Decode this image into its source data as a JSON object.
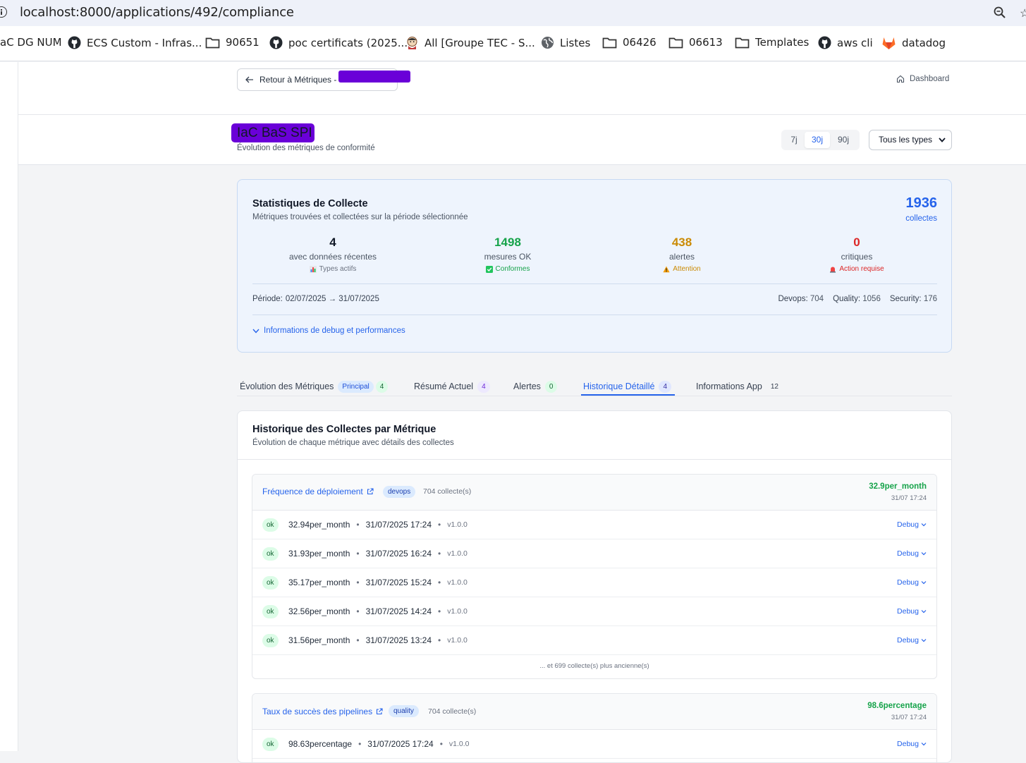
{
  "browser": {
    "url": "localhost:8000/applications/492/compliance",
    "bookmarks": [
      {
        "label": "aC DG NUM"
      },
      {
        "label": "ECS Custom - Infras..."
      },
      {
        "label": "90651"
      },
      {
        "label": "poc certificats (2025..."
      },
      {
        "label": "All [Groupe TEC - S..."
      },
      {
        "label": "Listes"
      },
      {
        "label": "06426"
      },
      {
        "label": "06613"
      },
      {
        "label": "Templates"
      },
      {
        "label": "aws cli"
      },
      {
        "label": "datadog"
      }
    ]
  },
  "nav": {
    "back_label": "Retour à Métriques -",
    "dashboard_label": "Dashboard"
  },
  "header": {
    "app_name": "IaC BaS SPI",
    "subtitle": "Évolution des métriques de conformité",
    "periods": [
      "7j",
      "30j",
      "90j"
    ],
    "active_period": "30j",
    "type_filter": "Tous les types"
  },
  "stats": {
    "title": "Statistiques de Collecte",
    "subtitle": "Métriques trouvées et collectées sur la période sélectionnée",
    "total": "1936",
    "total_label": "collectes",
    "items": [
      {
        "value": "4",
        "label": "avec données récentes",
        "sub": "Types actifs",
        "color": "#111827",
        "sub_color": "#6b7280"
      },
      {
        "value": "1498",
        "label": "mesures OK",
        "sub": "Conformes",
        "color": "#16a34a",
        "sub_color": "#16a34a"
      },
      {
        "value": "438",
        "label": "alertes",
        "sub": "Attention",
        "color": "#ca8a04",
        "sub_color": "#ca8a04"
      },
      {
        "value": "0",
        "label": "critiques",
        "sub": "Action requise",
        "color": "#dc2626",
        "sub_color": "#dc2626"
      }
    ],
    "period_label": "Période:",
    "period_value": "02/07/2025 → 31/07/2025",
    "breakdown": [
      {
        "label": "Devops:",
        "value": "704"
      },
      {
        "label": "Quality:",
        "value": "1056"
      },
      {
        "label": "Security:",
        "value": "176"
      }
    ],
    "debug_toggle": "Informations de debug et performances"
  },
  "tabs": [
    {
      "label": "Évolution des Métriques",
      "tag": "Principal",
      "count": "4"
    },
    {
      "label": "Résumé Actuel",
      "count": "4"
    },
    {
      "label": "Alertes",
      "count": "0"
    },
    {
      "label": "Historique Détaillé",
      "count": "4"
    },
    {
      "label": "Informations App",
      "count": "12"
    }
  ],
  "active_tab": "Historique Détaillé",
  "history": {
    "title": "Historique des Collectes par Métrique",
    "subtitle": "Évolution de chaque métrique avec détails des collectes",
    "groups": [
      {
        "name": "Fréquence de déploiement",
        "category": "devops",
        "count": "704 collecte(s)",
        "latest_value": "32.9per_month",
        "latest_date": "31/07 17:24",
        "rows": [
          {
            "status": "ok",
            "value": "32.94per_month",
            "date": "31/07/2025 17:24",
            "version": "v1.0.0",
            "debug": "Debug"
          },
          {
            "status": "ok",
            "value": "31.93per_month",
            "date": "31/07/2025 16:24",
            "version": "v1.0.0",
            "debug": "Debug"
          },
          {
            "status": "ok",
            "value": "35.17per_month",
            "date": "31/07/2025 15:24",
            "version": "v1.0.0",
            "debug": "Debug"
          },
          {
            "status": "ok",
            "value": "32.56per_month",
            "date": "31/07/2025 14:24",
            "version": "v1.0.0",
            "debug": "Debug"
          },
          {
            "status": "ok",
            "value": "31.56per_month",
            "date": "31/07/2025 13:24",
            "version": "v1.0.0",
            "debug": "Debug"
          }
        ],
        "more": "... et 699 collecte(s) plus ancienne(s)"
      },
      {
        "name": "Taux de succès des pipelines",
        "category": "quality",
        "count": "704 collecte(s)",
        "latest_value": "98.6percentage",
        "latest_date": "31/07 17:24",
        "rows": [
          {
            "status": "ok",
            "value": "98.63percentage",
            "date": "31/07/2025 17:24",
            "version": "v1.0.0",
            "debug": "Debug"
          }
        ]
      }
    ]
  }
}
